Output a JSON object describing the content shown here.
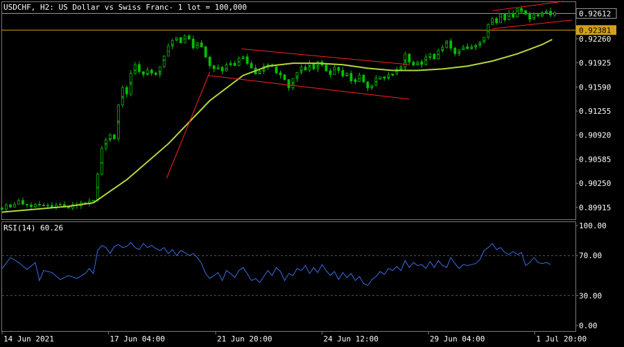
{
  "main_chart": {
    "title": "USDCHF, H2:  US Dollar vs Swiss Franc- 1 lot = 100,000",
    "price_ticks": [
      0.9226,
      0.91925,
      0.9159,
      0.91255,
      0.9092,
      0.90585,
      0.9025,
      0.89915
    ],
    "price_tick_labels": [
      "0.92260",
      "0.91925",
      "0.91590",
      "0.91255",
      "0.90920",
      "0.90585",
      "0.90250",
      "0.89915"
    ],
    "bid_price": 0.92612,
    "bid_price_label": "0.92612",
    "level_price": 0.92381,
    "level_price_label": "0.92381"
  },
  "rsi_panel": {
    "title": "RSI(14) 60.26",
    "tick_labels": [
      "100.00",
      "70.00",
      "30.00",
      "0.00"
    ],
    "levels": [
      70,
      30
    ]
  },
  "time_axis": {
    "labels": [
      "14 Jun 2021",
      "17 Jun 04:00",
      "21 Jun 20:00",
      "24 Jun 12:00",
      "29 Jun 04:00",
      "1 Jul 20:00"
    ]
  },
  "colors": {
    "candles": "#00c000",
    "moving_average": "#b5d93a",
    "trendlines": "#ff2020",
    "rsi_line": "#3a6ee8",
    "bid_line": "#a0a0a0",
    "level_line": "#d4a017",
    "grid": "#5a5a5a"
  },
  "chart_data": [
    {
      "type": "candlestick",
      "title": "USDCHF, H2:  US Dollar vs Swiss Franc- 1 lot = 100,000",
      "x_labels": [
        "14 Jun 2021",
        "17 Jun 04:00",
        "21 Jun 20:00",
        "24 Jun 12:00",
        "29 Jun 04:00",
        "1 Jul 20:00"
      ],
      "ylim": [
        0.8975,
        0.9277
      ],
      "close_path": [
        [
          0,
          0.8991
        ],
        [
          10,
          0.8995
        ],
        [
          20,
          0.8999
        ],
        [
          30,
          0.8996
        ],
        [
          40,
          0.8994
        ],
        [
          50,
          0.8992
        ],
        [
          60,
          0.8992
        ],
        [
          70,
          0.8995
        ],
        [
          80,
          0.8993
        ],
        [
          90,
          0.8996
        ],
        [
          100,
          0.8996
        ],
        [
          110,
          0.8999
        ],
        [
          115,
          0.9035
        ],
        [
          120,
          0.9075
        ],
        [
          125,
          0.9085
        ],
        [
          130,
          0.9095
        ],
        [
          135,
          0.909
        ],
        [
          140,
          0.9135
        ],
        [
          145,
          0.916
        ],
        [
          150,
          0.915
        ],
        [
          155,
          0.9175
        ],
        [
          160,
          0.919
        ],
        [
          165,
          0.918
        ],
        [
          170,
          0.9175
        ],
        [
          175,
          0.9185
        ],
        [
          180,
          0.918
        ],
        [
          185,
          0.9178
        ],
        [
          190,
          0.919
        ],
        [
          195,
          0.92
        ],
        [
          200,
          0.9215
        ],
        [
          205,
          0.9225
        ],
        [
          210,
          0.923
        ],
        [
          215,
          0.922
        ],
        [
          220,
          0.9228
        ],
        [
          225,
          0.9225
        ],
        [
          230,
          0.9215
        ],
        [
          235,
          0.922
        ],
        [
          240,
          0.9212
        ],
        [
          245,
          0.92
        ],
        [
          250,
          0.919
        ],
        [
          255,
          0.9185
        ],
        [
          260,
          0.9188
        ],
        [
          265,
          0.918
        ],
        [
          270,
          0.919
        ],
        [
          275,
          0.9192
        ],
        [
          280,
          0.9188
        ],
        [
          285,
          0.9197
        ],
        [
          290,
          0.92
        ],
        [
          295,
          0.9192
        ],
        [
          300,
          0.9185
        ],
        [
          305,
          0.9175
        ],
        [
          310,
          0.918
        ],
        [
          315,
          0.9185
        ],
        [
          320,
          0.9192
        ],
        [
          325,
          0.9188
        ],
        [
          330,
          0.918
        ],
        [
          335,
          0.9175
        ],
        [
          340,
          0.9168
        ],
        [
          345,
          0.916
        ],
        [
          350,
          0.917
        ],
        [
          355,
          0.918
        ],
        [
          360,
          0.9188
        ],
        [
          365,
          0.9183
        ],
        [
          370,
          0.919
        ],
        [
          375,
          0.9185
        ],
        [
          380,
          0.9193
        ],
        [
          385,
          0.919
        ],
        [
          390,
          0.9183
        ],
        [
          395,
          0.9178
        ],
        [
          400,
          0.9185
        ],
        [
          405,
          0.918
        ],
        [
          410,
          0.9175
        ],
        [
          415,
          0.918
        ],
        [
          420,
          0.917
        ],
        [
          425,
          0.9165
        ],
        [
          430,
          0.9175
        ],
        [
          435,
          0.9163
        ],
        [
          440,
          0.9158
        ],
        [
          445,
          0.9162
        ],
        [
          450,
          0.917
        ],
        [
          455,
          0.9175
        ],
        [
          460,
          0.9172
        ],
        [
          465,
          0.9178
        ],
        [
          470,
          0.918
        ],
        [
          475,
          0.9183
        ],
        [
          480,
          0.9186
        ],
        [
          485,
          0.9202
        ],
        [
          490,
          0.9195
        ],
        [
          495,
          0.919
        ],
        [
          500,
          0.9195
        ],
        [
          505,
          0.9192
        ],
        [
          510,
          0.9198
        ],
        [
          515,
          0.9205
        ],
        [
          520,
          0.92
        ],
        [
          525,
          0.921
        ],
        [
          530,
          0.9215
        ],
        [
          535,
          0.922
        ],
        [
          540,
          0.9212
        ],
        [
          545,
          0.9205
        ],
        [
          550,
          0.921
        ],
        [
          555,
          0.9215
        ],
        [
          560,
          0.921
        ],
        [
          565,
          0.9213
        ],
        [
          570,
          0.9216
        ],
        [
          575,
          0.922
        ],
        [
          580,
          0.9228
        ],
        [
          585,
          0.9245
        ],
        [
          590,
          0.9255
        ],
        [
          595,
          0.925
        ],
        [
          600,
          0.9258
        ],
        [
          605,
          0.9255
        ],
        [
          610,
          0.9262
        ],
        [
          615,
          0.9258
        ],
        [
          620,
          0.9265
        ],
        [
          625,
          0.9268
        ],
        [
          630,
          0.9258
        ],
        [
          635,
          0.9255
        ],
        [
          640,
          0.9262
        ],
        [
          645,
          0.9258
        ],
        [
          650,
          0.926
        ],
        [
          655,
          0.9263
        ],
        [
          660,
          0.9261
        ]
      ],
      "moving_average": [
        [
          0,
          0.8985
        ],
        [
          40,
          0.8989
        ],
        [
          80,
          0.8993
        ],
        [
          110,
          0.8998
        ],
        [
          150,
          0.903
        ],
        [
          200,
          0.908
        ],
        [
          250,
          0.914
        ],
        [
          290,
          0.9175
        ],
        [
          320,
          0.9188
        ],
        [
          350,
          0.9192
        ],
        [
          380,
          0.9192
        ],
        [
          410,
          0.919
        ],
        [
          440,
          0.9185
        ],
        [
          470,
          0.9182
        ],
        [
          500,
          0.9182
        ],
        [
          530,
          0.9184
        ],
        [
          560,
          0.9188
        ],
        [
          590,
          0.9195
        ],
        [
          620,
          0.9205
        ],
        [
          650,
          0.9218
        ],
        [
          662,
          0.9225
        ]
      ],
      "trendlines": [
        [
          [
            198,
            0.9032
          ],
          [
            250,
            0.918
          ]
        ],
        [
          [
            248,
            0.9175
          ],
          [
            490,
            0.9142
          ]
        ],
        [
          [
            288,
            0.9212
          ],
          [
            490,
            0.919
          ]
        ],
        [
          [
            590,
            0.924
          ],
          [
            686,
            0.9252
          ]
        ],
        [
          [
            590,
            0.9265
          ],
          [
            675,
            0.9278
          ]
        ]
      ]
    },
    {
      "type": "line",
      "title": "RSI(14) 60.26",
      "ylim": [
        0,
        100
      ],
      "tick_labels": [
        "100.00",
        "70.00",
        "30.00",
        "0.00"
      ],
      "levels": [
        70,
        30
      ],
      "values": [
        [
          0,
          57
        ],
        [
          10,
          68
        ],
        [
          20,
          63
        ],
        [
          30,
          56
        ],
        [
          40,
          63
        ],
        [
          45,
          45
        ],
        [
          50,
          55
        ],
        [
          60,
          53
        ],
        [
          70,
          46
        ],
        [
          80,
          50
        ],
        [
          90,
          47
        ],
        [
          100,
          52
        ],
        [
          105,
          57
        ],
        [
          110,
          52
        ],
        [
          115,
          75
        ],
        [
          120,
          80
        ],
        [
          125,
          78
        ],
        [
          130,
          72
        ],
        [
          135,
          79
        ],
        [
          140,
          81
        ],
        [
          145,
          78
        ],
        [
          150,
          79
        ],
        [
          155,
          83
        ],
        [
          160,
          78
        ],
        [
          165,
          76
        ],
        [
          170,
          82
        ],
        [
          175,
          78
        ],
        [
          180,
          80
        ],
        [
          185,
          77
        ],
        [
          190,
          75
        ],
        [
          195,
          78
        ],
        [
          200,
          72
        ],
        [
          205,
          76
        ],
        [
          210,
          70
        ],
        [
          215,
          75
        ],
        [
          220,
          73
        ],
        [
          225,
          70
        ],
        [
          230,
          72
        ],
        [
          235,
          68
        ],
        [
          240,
          62
        ],
        [
          245,
          52
        ],
        [
          250,
          47
        ],
        [
          255,
          50
        ],
        [
          260,
          53
        ],
        [
          265,
          45
        ],
        [
          270,
          55
        ],
        [
          275,
          52
        ],
        [
          280,
          48
        ],
        [
          285,
          55
        ],
        [
          290,
          58
        ],
        [
          295,
          52
        ],
        [
          300,
          45
        ],
        [
          305,
          47
        ],
        [
          310,
          43
        ],
        [
          315,
          49
        ],
        [
          320,
          55
        ],
        [
          325,
          50
        ],
        [
          330,
          58
        ],
        [
          335,
          54
        ],
        [
          340,
          45
        ],
        [
          345,
          52
        ],
        [
          350,
          50
        ],
        [
          355,
          57
        ],
        [
          360,
          55
        ],
        [
          365,
          60
        ],
        [
          370,
          52
        ],
        [
          375,
          58
        ],
        [
          380,
          53
        ],
        [
          385,
          61
        ],
        [
          390,
          55
        ],
        [
          395,
          50
        ],
        [
          400,
          54
        ],
        [
          405,
          46
        ],
        [
          410,
          53
        ],
        [
          415,
          48
        ],
        [
          420,
          52
        ],
        [
          425,
          45
        ],
        [
          430,
          49
        ],
        [
          435,
          42
        ],
        [
          440,
          40
        ],
        [
          445,
          46
        ],
        [
          450,
          49
        ],
        [
          455,
          54
        ],
        [
          460,
          51
        ],
        [
          465,
          57
        ],
        [
          470,
          55
        ],
        [
          475,
          59
        ],
        [
          480,
          55
        ],
        [
          485,
          65
        ],
        [
          490,
          58
        ],
        [
          495,
          63
        ],
        [
          500,
          60
        ],
        [
          505,
          61
        ],
        [
          510,
          57
        ],
        [
          515,
          64
        ],
        [
          520,
          58
        ],
        [
          525,
          65
        ],
        [
          530,
          60
        ],
        [
          535,
          58
        ],
        [
          540,
          68
        ],
        [
          545,
          62
        ],
        [
          550,
          57
        ],
        [
          555,
          61
        ],
        [
          560,
          60
        ],
        [
          565,
          61
        ],
        [
          570,
          62
        ],
        [
          575,
          66
        ],
        [
          580,
          75
        ],
        [
          585,
          78
        ],
        [
          590,
          82
        ],
        [
          595,
          76
        ],
        [
          600,
          78
        ],
        [
          605,
          73
        ],
        [
          610,
          71
        ],
        [
          615,
          74
        ],
        [
          620,
          71
        ],
        [
          625,
          73
        ],
        [
          630,
          60
        ],
        [
          635,
          63
        ],
        [
          640,
          68
        ],
        [
          645,
          63
        ],
        [
          650,
          62
        ],
        [
          655,
          63
        ],
        [
          660,
          61
        ]
      ]
    }
  ]
}
